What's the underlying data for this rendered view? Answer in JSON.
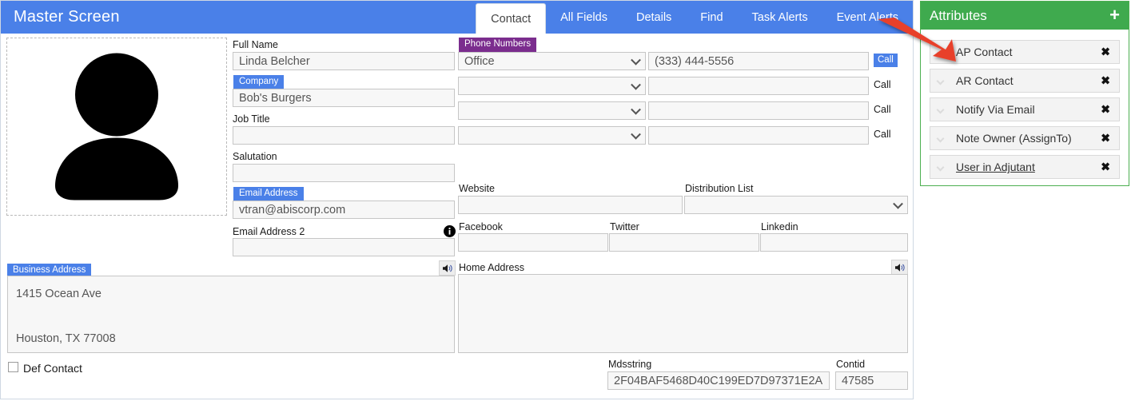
{
  "header": {
    "app_title": "Master Screen",
    "tabs": [
      {
        "label": "Contact",
        "active": true
      },
      {
        "label": "All Fields",
        "active": false
      },
      {
        "label": "Details",
        "active": false
      },
      {
        "label": "Find",
        "active": false
      },
      {
        "label": "Task Alerts",
        "active": false
      },
      {
        "label": "Event Alerts",
        "active": false
      }
    ]
  },
  "colors": {
    "header_blue": "#4a80e8",
    "attr_green": "#3faa4e",
    "tag_purple": "#7b2d8e",
    "arrow_red": "#e8402a"
  },
  "avatar": {
    "icon": "user-avatar-icon"
  },
  "contact": {
    "full_name_label": "Full Name",
    "full_name_value": "Linda Belcher",
    "company_label": "Company",
    "company_value": "Bob's Burgers",
    "job_title_label": "Job Title",
    "job_title_value": "",
    "salutation_label": "Salutation",
    "salutation_value": "",
    "email_address_label": "Email Address",
    "email_address_value": "vtran@abiscorp.com",
    "email_address_2_label": "Email Address 2",
    "email_address_2_value": "",
    "email_info_icon": "info-circle-icon"
  },
  "phones": {
    "section_label": "Phone Numbers",
    "rows": [
      {
        "type": "Office",
        "number": "(333) 444-5556",
        "call_label": "Call",
        "call_primary": true
      },
      {
        "type": "",
        "number": "",
        "call_label": "Call",
        "call_primary": false
      },
      {
        "type": "",
        "number": "",
        "call_label": "Call",
        "call_primary": false
      },
      {
        "type": "",
        "number": "",
        "call_label": "Call",
        "call_primary": false
      }
    ]
  },
  "web": {
    "website_label": "Website",
    "website_value": "",
    "distribution_list_label": "Distribution List",
    "distribution_list_value": "",
    "facebook_label": "Facebook",
    "facebook_value": "",
    "twitter_label": "Twitter",
    "twitter_value": "",
    "linkedin_label": "Linkedin",
    "linkedin_value": ""
  },
  "addresses": {
    "business_label": "Business Address",
    "business_value": "1415 Ocean Ave\n\nHouston, TX 77008",
    "business_speaker_icon": "speaker-icon",
    "home_label": "Home Address",
    "home_value": "",
    "home_speaker_icon": "speaker-icon"
  },
  "footer": {
    "def_contact_label": "Def Contact",
    "def_contact_checked": false,
    "mdsstring_label": "Mdsstring",
    "mdsstring_value": "2F04BAF5468D40C199ED7D97371E2A",
    "contid_label": "Contid",
    "contid_value": "47585"
  },
  "attributes": {
    "title": "Attributes",
    "add_icon": "plus-icon",
    "items": [
      {
        "label": "AP Contact",
        "remove_icon": "close-icon",
        "underline": false
      },
      {
        "label": "AR Contact",
        "remove_icon": "close-icon",
        "underline": false
      },
      {
        "label": "Notify Via Email",
        "remove_icon": "close-icon",
        "underline": false
      },
      {
        "label": "Note Owner (AssignTo)",
        "remove_icon": "close-icon",
        "underline": false
      },
      {
        "label": "User in Adjutant",
        "remove_icon": "close-icon",
        "underline": true
      }
    ]
  },
  "annotation": {
    "arrow_icon": "red-arrow-icon"
  }
}
